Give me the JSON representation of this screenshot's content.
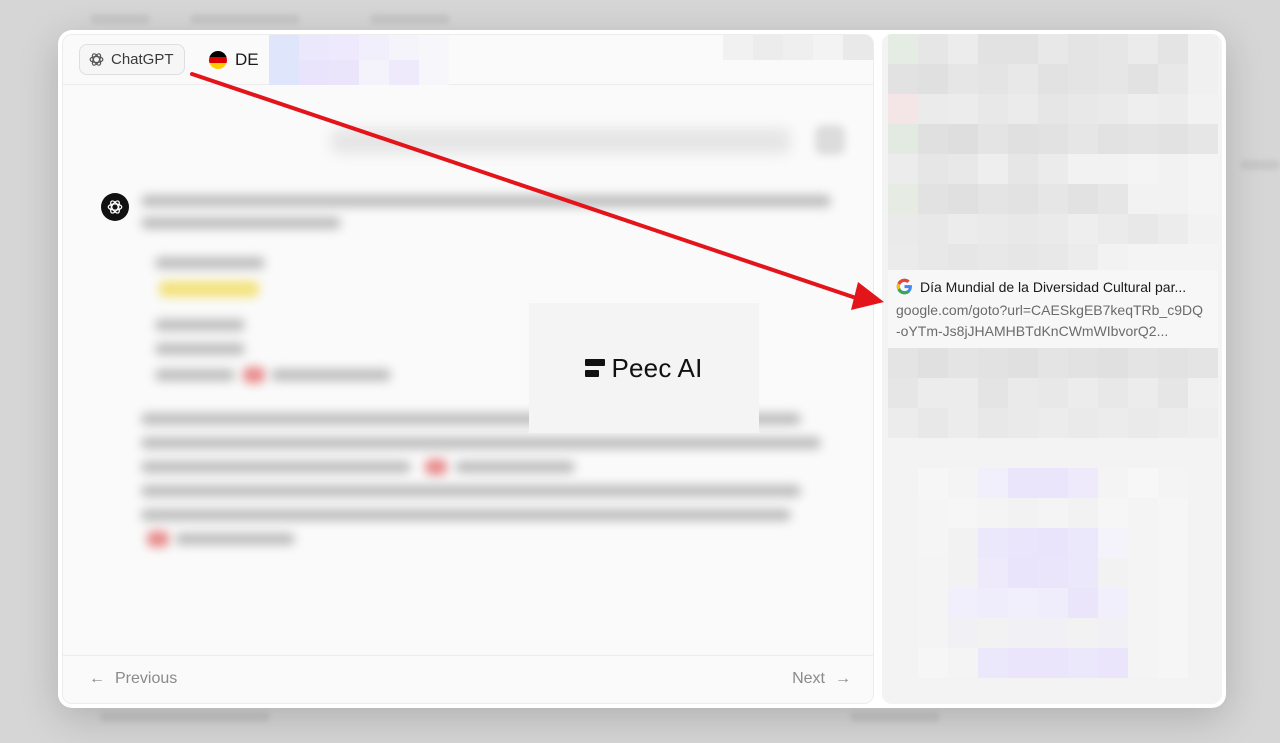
{
  "header": {
    "model_chip": {
      "label": "ChatGPT",
      "icon": "openai-icon"
    },
    "country_chip": {
      "label": "DE",
      "icon": "germany-flag-icon"
    }
  },
  "logo": {
    "text": "Peec AI"
  },
  "source": {
    "title": "Día Mundial de la Diversidad Cultural par...",
    "url": "google.com/goto?url=CAESkgEB7keqTRb_c9DQ-oYTm-Js8jJHAMHBTdKnCWmWIbvorQ2...",
    "icon": "google-icon"
  },
  "footer": {
    "previous_label": "Previous",
    "next_label": "Next"
  },
  "colors": {
    "annotation_arrow": "#e4141b",
    "flag_black": "#000000",
    "flag_red": "#dd0000",
    "flag_gold": "#ffce00"
  }
}
